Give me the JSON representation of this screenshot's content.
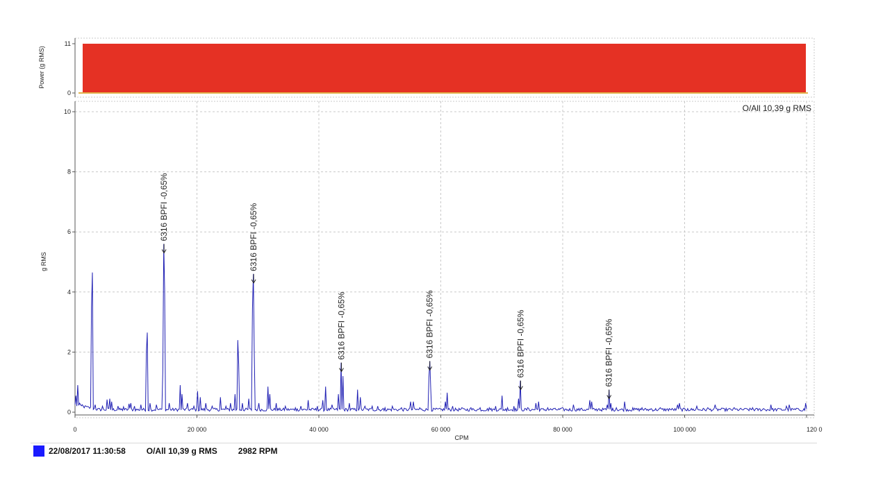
{
  "chart_data": [
    {
      "type": "area",
      "name": "power-strip",
      "ylabel": "Power (g RMS)",
      "yticks": [
        0,
        11
      ],
      "ylim": [
        0,
        11
      ],
      "bar": {
        "from": 0,
        "to": 11,
        "color": "#e53124"
      },
      "baseline_color": "#e0b24a"
    },
    {
      "type": "line",
      "xlabel": "CPM",
      "ylabel": "g RMS",
      "xlim": [
        0,
        120000
      ],
      "ylim": [
        0,
        10.5
      ],
      "xticks": [
        0,
        20000,
        40000,
        60000,
        80000,
        100000,
        120000
      ],
      "xtick_labels": [
        "0",
        "20 000",
        "40 000",
        "60 000",
        "80 000",
        "100 000",
        "120 0"
      ],
      "yticks": [
        0,
        2,
        4,
        6,
        8,
        10
      ],
      "ytick_labels": [
        "0",
        "2",
        "4",
        "6",
        "8",
        "10"
      ],
      "grid": true,
      "line_color": "#1f1fb3",
      "overall_label": "O/All 10,39 g RMS",
      "noise_floor": 0.08,
      "peaks": [
        [
          200,
          0.55
        ],
        [
          400,
          0.9
        ],
        [
          800,
          0.3
        ],
        [
          1200,
          0.25
        ],
        [
          1800,
          0.2
        ],
        [
          2700,
          3.5
        ],
        [
          2800,
          4.65
        ],
        [
          3300,
          0.25
        ],
        [
          4500,
          0.2
        ],
        [
          5300,
          0.42
        ],
        [
          5700,
          0.45
        ],
        [
          6000,
          0.35
        ],
        [
          7000,
          0.2
        ],
        [
          8000,
          0.18
        ],
        [
          8800,
          0.28
        ],
        [
          9200,
          0.3
        ],
        [
          9800,
          0.2
        ],
        [
          10800,
          0.25
        ],
        [
          11700,
          2.0
        ],
        [
          11800,
          2.65
        ],
        [
          12300,
          0.3
        ],
        [
          13300,
          0.25
        ],
        [
          14450,
          1.4
        ],
        [
          14600,
          5.6
        ],
        [
          14700,
          4.1
        ],
        [
          15500,
          0.3
        ],
        [
          17300,
          0.9
        ],
        [
          17600,
          0.6
        ],
        [
          18500,
          0.3
        ],
        [
          19500,
          0.2
        ],
        [
          20100,
          0.7
        ],
        [
          20500,
          0.5
        ],
        [
          21500,
          0.3
        ],
        [
          22500,
          0.2
        ],
        [
          23800,
          0.5
        ],
        [
          24800,
          0.2
        ],
        [
          25500,
          0.3
        ],
        [
          26300,
          0.6
        ],
        [
          26700,
          2.4
        ],
        [
          26900,
          1.6
        ],
        [
          27500,
          0.3
        ],
        [
          28500,
          0.45
        ],
        [
          29100,
          3.45
        ],
        [
          29300,
          4.6
        ],
        [
          29400,
          2.0
        ],
        [
          30200,
          0.3
        ],
        [
          31600,
          0.85
        ],
        [
          31900,
          0.6
        ],
        [
          33000,
          0.3
        ],
        [
          34500,
          0.2
        ],
        [
          36200,
          0.15
        ],
        [
          37000,
          0.2
        ],
        [
          38300,
          0.4
        ],
        [
          39700,
          0.2
        ],
        [
          40700,
          0.4
        ],
        [
          41100,
          0.85
        ],
        [
          42200,
          0.25
        ],
        [
          43200,
          0.6
        ],
        [
          43700,
          1.65
        ],
        [
          43900,
          1.2
        ],
        [
          45000,
          0.3
        ],
        [
          46400,
          0.75
        ],
        [
          46800,
          0.5
        ],
        [
          47500,
          0.2
        ],
        [
          48700,
          0.2
        ],
        [
          49600,
          0.2
        ],
        [
          50800,
          0.15
        ],
        [
          52100,
          0.2
        ],
        [
          53600,
          0.15
        ],
        [
          55100,
          0.35
        ],
        [
          55500,
          0.35
        ],
        [
          56600,
          0.15
        ],
        [
          58000,
          1.15
        ],
        [
          58200,
          1.7
        ],
        [
          58400,
          0.8
        ],
        [
          60800,
          0.35
        ],
        [
          61100,
          0.65
        ],
        [
          62000,
          0.2
        ],
        [
          63400,
          0.15
        ],
        [
          65000,
          0.15
        ],
        [
          66500,
          0.15
        ],
        [
          68000,
          0.15
        ],
        [
          69000,
          0.2
        ],
        [
          70000,
          0.55
        ],
        [
          71000,
          0.15
        ],
        [
          72000,
          0.2
        ],
        [
          72800,
          0.45
        ],
        [
          73100,
          1.05
        ],
        [
          74200,
          0.15
        ],
        [
          75600,
          0.3
        ],
        [
          76000,
          0.35
        ],
        [
          77500,
          0.15
        ],
        [
          78500,
          0.12
        ],
        [
          80000,
          0.15
        ],
        [
          81800,
          0.25
        ],
        [
          83000,
          0.12
        ],
        [
          84400,
          0.4
        ],
        [
          84800,
          0.35
        ],
        [
          86000,
          0.12
        ],
        [
          87300,
          0.25
        ],
        [
          87600,
          0.75
        ],
        [
          87900,
          0.3
        ],
        [
          88800,
          0.15
        ],
        [
          90100,
          0.35
        ],
        [
          91500,
          0.15
        ],
        [
          93000,
          0.15
        ],
        [
          94500,
          0.12
        ],
        [
          96000,
          0.15
        ],
        [
          97500,
          0.12
        ],
        [
          98900,
          0.25
        ],
        [
          99200,
          0.3
        ],
        [
          100500,
          0.12
        ],
        [
          102000,
          0.2
        ],
        [
          103800,
          0.15
        ],
        [
          105000,
          0.25
        ],
        [
          106500,
          0.12
        ],
        [
          108200,
          0.15
        ],
        [
          109800,
          0.12
        ],
        [
          111200,
          0.15
        ],
        [
          113000,
          0.12
        ],
        [
          114200,
          0.25
        ],
        [
          115500,
          0.12
        ],
        [
          116700,
          0.2
        ],
        [
          117200,
          0.25
        ],
        [
          118600,
          0.12
        ],
        [
          119900,
          0.3
        ]
      ],
      "annotations": [
        {
          "text": "6316 BPFI -0,65%",
          "x": 14600,
          "y": 5.6
        },
        {
          "text": "6316 BPFI -0,65%",
          "x": 29300,
          "y": 4.6
        },
        {
          "text": "6316 BPFI -0,65%",
          "x": 43700,
          "y": 1.65
        },
        {
          "text": "6316 BPFI -0,65%",
          "x": 58200,
          "y": 1.7
        },
        {
          "text": "6316 BPFI -0,65%",
          "x": 73100,
          "y": 1.05
        },
        {
          "text": "6316 BPFI -0,65%",
          "x": 87600,
          "y": 0.75
        }
      ]
    }
  ],
  "status_bar": {
    "swatch_color": "#1a1aff",
    "timestamp": "22/08/2017 11:30:58",
    "overall": "O/All 10,39 g RMS",
    "speed": "2982 RPM"
  }
}
